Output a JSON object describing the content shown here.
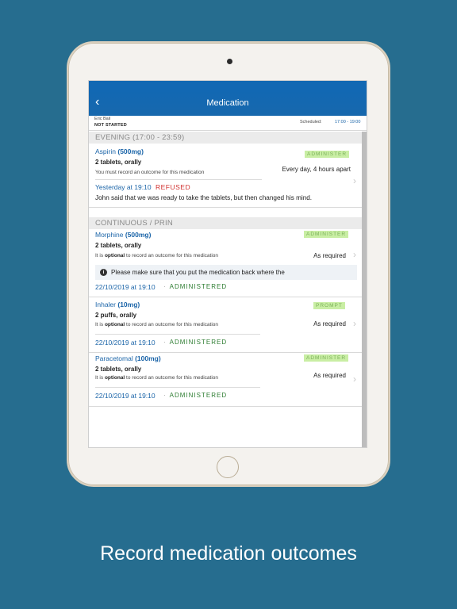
{
  "nav": {
    "back_icon": "chevron-left-icon",
    "back_glyph": "‹",
    "title": "Medication"
  },
  "patient": {
    "name": "Eric Bail",
    "status": "NOT STARTED",
    "scheduled_label": "Scheduled:",
    "scheduled_value": "17:00 - 19:00"
  },
  "sections": [
    {
      "title": "EVENING (17:00 - 23:59)"
    },
    {
      "title": "CONTINUOUS / PRIN"
    }
  ],
  "meds": [
    {
      "name": "Aspirin",
      "strength": "(500mg)",
      "dose": "2 tablets, orally",
      "note": "You must record an outcome for this medication",
      "badge": "ADMINISTER",
      "frequency": "Every day, 4 hours apart",
      "last_when": "Yesterday at 19:10",
      "last_outcome": "REFUSED",
      "comment": "John said that we was ready to take the tablets, but then changed his mind."
    },
    {
      "name": "Morphine",
      "strength": "(500mg)",
      "dose": "2 tablets, orally",
      "note_pre": "It is",
      "note_bold": "optional",
      "note_post": "to record an outcome for this medication",
      "badge": "ADMINISTER",
      "frequency": "As required",
      "info": "Please make sure that you put the medication back where the",
      "last_when": "22/10/2019 at 19:10",
      "last_outcome": "ADMINISTERED"
    },
    {
      "name": "Inhaler",
      "strength": "(10mg)",
      "dose": "2 puffs, orally",
      "note_pre": "It is",
      "note_bold": "optional",
      "note_post": "to record an outcome for this medication",
      "badge": "PROMPT",
      "frequency": "As required",
      "last_when": "22/10/2019 at 19:10",
      "last_outcome": "ADMINISTERED"
    },
    {
      "name": "Paracetomal",
      "strength": "(100mg)",
      "dose": "2 tablets, orally",
      "note_pre": "It is",
      "note_bold": "optional",
      "note_post": "to record an outcome for this medication",
      "badge": "ADMINISTER",
      "frequency": "As required",
      "last_when": "22/10/2019 at 19:10",
      "last_outcome": "ADMINISTERED"
    }
  ],
  "dot": "·",
  "chevron_glyph": "›",
  "info_glyph": "i",
  "caption": "Record medication outcomes",
  "colors": {
    "background": "#266d8f",
    "nav": "#1268b3",
    "link": "#1a64a8",
    "badge_bg": "#c9eea4",
    "refused": "#d0302f",
    "administered": "#2e7d32"
  }
}
